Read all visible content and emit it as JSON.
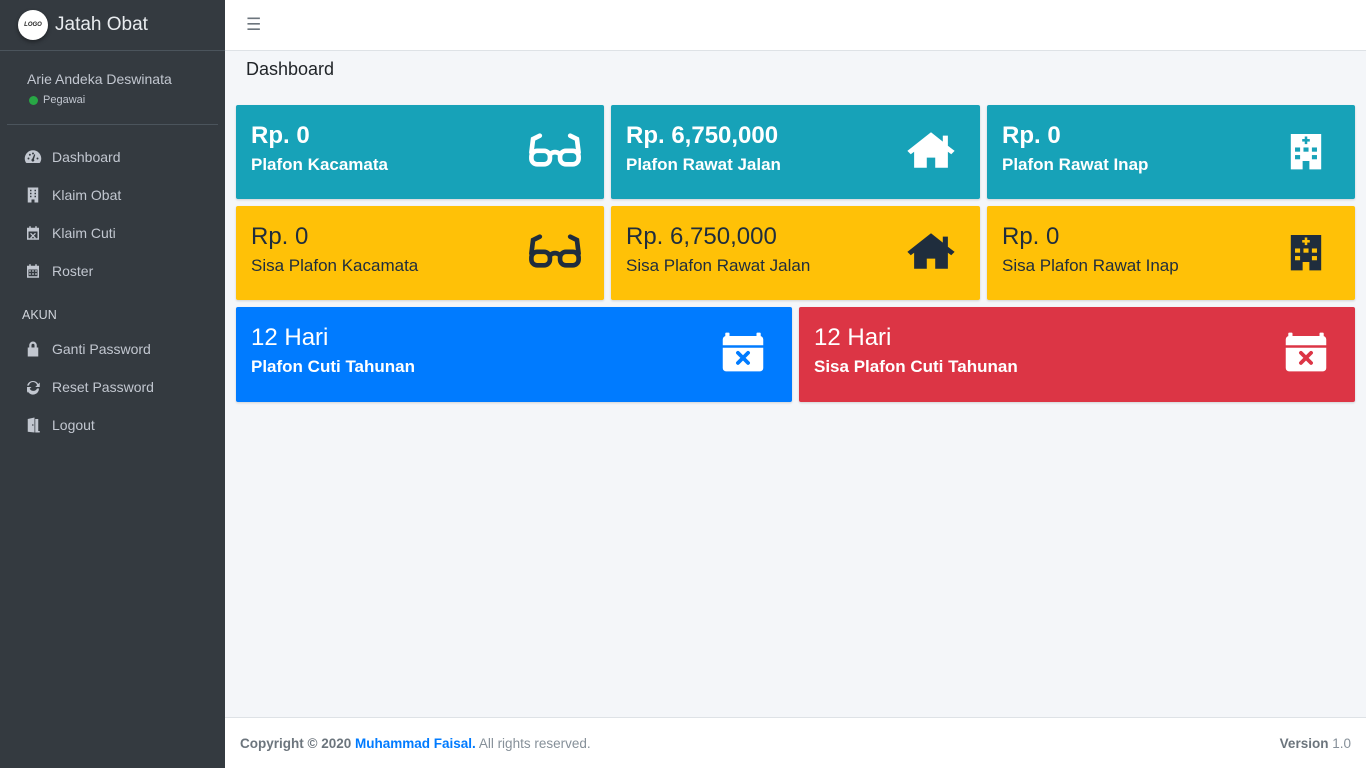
{
  "brand": {
    "logo_text": "LOGO",
    "title": "Jatah Obat"
  },
  "user": {
    "name": "Arie Andeka Deswinata",
    "status": "Pegawai"
  },
  "nav": {
    "items": [
      {
        "label": "Dashboard",
        "icon": "tachometer-icon"
      },
      {
        "label": "Klaim Obat",
        "icon": "building-icon"
      },
      {
        "label": "Klaim Cuti",
        "icon": "calendar-times-icon"
      },
      {
        "label": "Roster",
        "icon": "calendar-icon"
      }
    ],
    "header": "AKUN",
    "account_items": [
      {
        "label": "Ganti Password",
        "icon": "lock-icon"
      },
      {
        "label": "Reset Password",
        "icon": "sync-icon"
      },
      {
        "label": "Logout",
        "icon": "door-open-icon"
      }
    ]
  },
  "page": {
    "title": "Dashboard"
  },
  "boxes": [
    {
      "amount": "Rp. 0",
      "label": "Plafon Kacamata",
      "icon": "glasses-icon",
      "color": "#17a2b8"
    },
    {
      "amount": "Rp. 6,750,000",
      "label": "Plafon Rawat Jalan",
      "icon": "home-icon",
      "color": "#17a2b8"
    },
    {
      "amount": "Rp. 0",
      "label": "Plafon Rawat Inap",
      "icon": "hospital-icon",
      "color": "#17a2b8"
    },
    {
      "amount": "Rp. 0",
      "label": "Sisa Plafon Kacamata",
      "icon": "glasses-icon",
      "color": "#ffc107"
    },
    {
      "amount": "Rp. 6,750,000",
      "label": "Sisa Plafon Rawat Jalan",
      "icon": "home-icon",
      "color": "#ffc107"
    },
    {
      "amount": "Rp. 0",
      "label": "Sisa Plafon Rawat Inap",
      "icon": "hospital-icon",
      "color": "#ffc107"
    },
    {
      "amount": "12 Hari",
      "label": "Plafon Cuti Tahunan",
      "icon": "calendar-times-icon",
      "color": "#007bff"
    },
    {
      "amount": "12 Hari",
      "label": "Sisa Plafon Cuti Tahunan",
      "icon": "calendar-times-icon",
      "color": "#dc3545"
    }
  ],
  "footer": {
    "copyright": "Copyright © 2020",
    "author": "Muhammad Faisal.",
    "rights": "All rights reserved.",
    "version_label": "Version",
    "version": "1.0"
  }
}
